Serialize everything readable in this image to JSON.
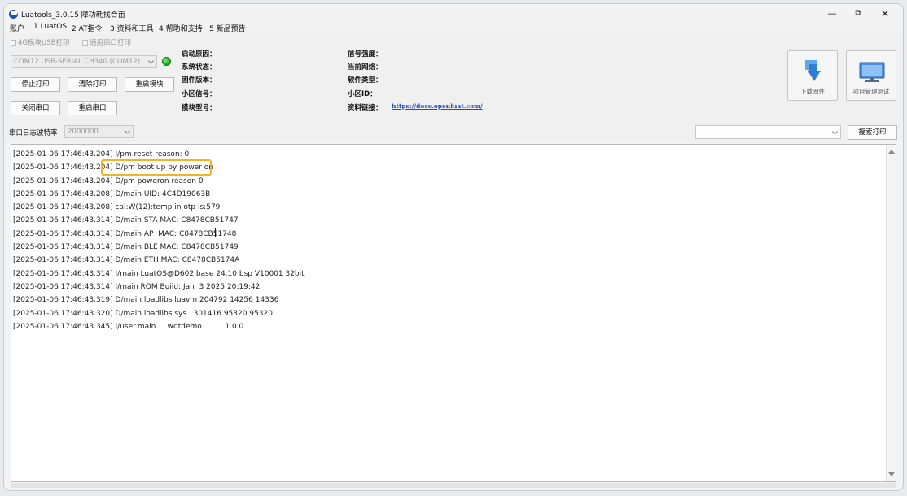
{
  "window": {
    "title": "Luatools_3.0.15 障功耗找合亩",
    "controls": {
      "minimize": "—",
      "maximize": "⧉",
      "close": "✕"
    }
  },
  "menu": [
    "账户",
    "1 LuatOS",
    "2 AT指令",
    "3 资料和工具",
    "4 帮助和支持",
    "5 新品预告"
  ],
  "controls": {
    "checkbox_4g_usb": "4G模块USB打印",
    "checkbox_serial": "通用串口打印",
    "port_select": "COM12 USB-SERIAL CH340 (COM12)",
    "btn_stop_print": "停止打印",
    "btn_clear_print": "清除打印",
    "btn_restart_module": "重启模块",
    "btn_close_port": "关闭串口",
    "btn_restart_port": "重启串口",
    "baud_label": "串口日志波特率",
    "baud_value": "2000000",
    "search_value": "",
    "btn_search_print": "搜索打印",
    "btn_download_firmware": "下载固件",
    "btn_project_test": "项目管理测试"
  },
  "info": {
    "boot_reason": "启动原因：",
    "system_status": "系统状态：",
    "firmware_version": "固件版本：",
    "cell_signal": "小区信号：",
    "module_model": "模块型号：",
    "signal_strength": "信号强度：",
    "current_network": "当前网络：",
    "software_type": "软件类型：",
    "cell_id": "小区ID：",
    "resource_link": "资料链接：",
    "link_url": "https://docs.openluat.com/"
  },
  "log_lines": [
    "[2025-01-06 17:46:43.204] I/pm reset reason: 0",
    "[2025-01-06 17:46:43.204] D/pm boot up by power on",
    "[2025-01-06 17:46:43.204] D/pm poweron reason 0",
    "[2025-01-06 17:46:43.208] D/main UID: 4C4D19063B",
    "[2025-01-06 17:46:43.208] cal:W(12):temp in otp is:579",
    "[2025-01-06 17:46:43.314] D/main STA MAC: C8478CB51747",
    "[2025-01-06 17:46:43.314] D/main AP  MAC: C8478CB51748",
    "[2025-01-06 17:46:43.314] D/main BLE MAC: C8478CB51749",
    "[2025-01-06 17:46:43.314] D/main ETH MAC: C8478CB5174A",
    "[2025-01-06 17:46:43.314] I/main LuatOS@D602 base 24.10 bsp V10001 32bit",
    "[2025-01-06 17:46:43.314] I/main ROM Build: Jan  3 2025 20:19:42",
    "[2025-01-06 17:46:43.319] D/main loadlibs luavm 204792 14256 14336",
    "[2025-01-06 17:46:43.320] D/main loadlibs sys   301416 95320 95320",
    "[2025-01-06 17:46:43.345] I/user.main     wdtdemo          1.0.0"
  ],
  "colors": {
    "accent_link": "#1f4cc7",
    "status_led": "#1fb11f",
    "highlight": "#f0b429"
  },
  "icons": [
    "app-logo-icon",
    "status-led-icon",
    "download-arrow-icon",
    "monitor-icon",
    "chevron-down-icon"
  ]
}
